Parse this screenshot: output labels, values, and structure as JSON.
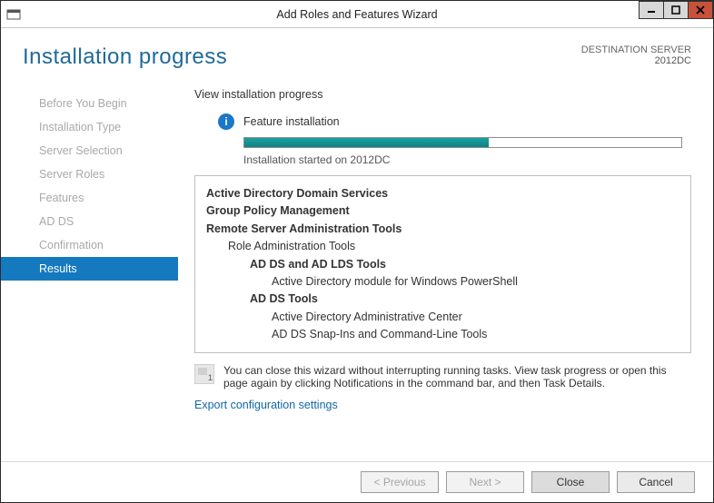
{
  "window": {
    "title": "Add Roles and Features Wizard"
  },
  "header": {
    "title": "Installation progress",
    "dest_label": "DESTINATION SERVER",
    "dest_value": "2012DC"
  },
  "sidebar": {
    "steps": [
      "Before You Begin",
      "Installation Type",
      "Server Selection",
      "Server Roles",
      "Features",
      "AD DS",
      "Confirmation",
      "Results"
    ],
    "active_index": 7
  },
  "main": {
    "view_label": "View installation progress",
    "status": "Feature installation",
    "progress_percent": 56,
    "progress_text": "Installation started on 2012DC",
    "details": [
      {
        "text": "Active Directory Domain Services",
        "cls": "l0"
      },
      {
        "text": "Group Policy Management",
        "cls": "l0"
      },
      {
        "text": "Remote Server Administration Tools",
        "cls": "l0"
      },
      {
        "text": "Role Administration Tools",
        "cls": "l1"
      },
      {
        "text": "AD DS and AD LDS Tools",
        "cls": "l2"
      },
      {
        "text": "Active Directory module for Windows PowerShell",
        "cls": "l3"
      },
      {
        "text": "AD DS Tools",
        "cls": "l2b"
      },
      {
        "text": "Active Directory Administrative Center",
        "cls": "l3b"
      },
      {
        "text": "AD DS Snap-Ins and Command-Line Tools",
        "cls": "l3b"
      }
    ],
    "hint": "You can close this wizard without interrupting running tasks. View task progress or open this page again by clicking Notifications in the command bar, and then Task Details.",
    "export_link": "Export configuration settings"
  },
  "footer": {
    "previous": "< Previous",
    "next": "Next >",
    "close": "Close",
    "cancel": "Cancel"
  }
}
